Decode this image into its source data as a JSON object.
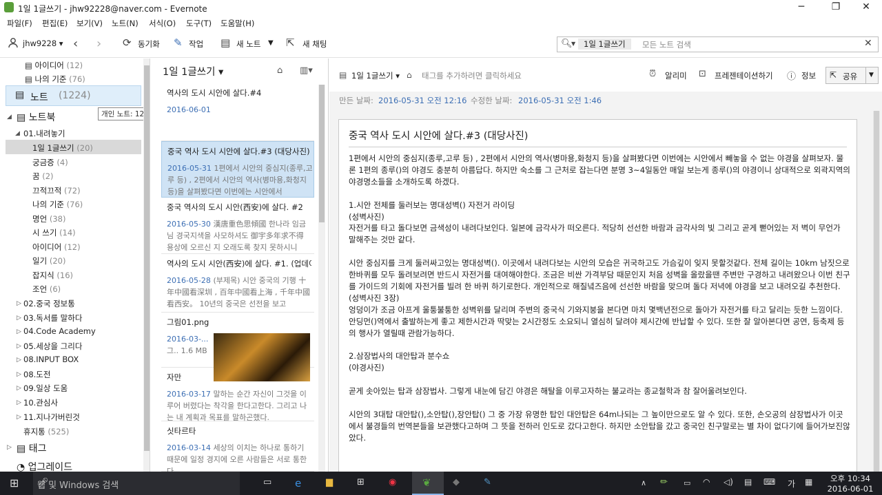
{
  "window": {
    "title": "1일 1글쓰기 - jhw92228@naver.com - Evernote"
  },
  "menu": [
    "파일(F)",
    "편집(E)",
    "보기(V)",
    "노트(N)",
    "서식(O)",
    "도구(T)",
    "도움말(H)"
  ],
  "toolbar": {
    "user": "jhw9228",
    "sync": "동기화",
    "work": "작업",
    "new_note": "새 노트",
    "new_chat": "새 채팅"
  },
  "search": {
    "scope": "1일 1글쓰기",
    "placeholder": "모든 노트 검색"
  },
  "sidebar": {
    "top_items": [
      {
        "label": "아이디어",
        "count": "(12)"
      },
      {
        "label": "나의 기준",
        "count": "(76)"
      }
    ],
    "notes": {
      "label": "노트",
      "count": "(1224)"
    },
    "tooltip": "개인 노트: 1224개",
    "notebooks_label": "노트북",
    "stack": "01.내려놓기",
    "stack_items": [
      {
        "label": "1일 1글쓰기",
        "count": "(20)"
      },
      {
        "label": "궁금증",
        "count": "(4)"
      },
      {
        "label": "꿈",
        "count": "(2)"
      },
      {
        "label": "끄적끄적",
        "count": "(72)"
      },
      {
        "label": "나의 기준",
        "count": "(76)"
      },
      {
        "label": "명언",
        "count": "(38)"
      },
      {
        "label": "시 쓰기",
        "count": "(14)"
      },
      {
        "label": "아이디어",
        "count": "(12)"
      },
      {
        "label": "일기",
        "count": "(20)"
      },
      {
        "label": "잡지식",
        "count": "(16)"
      },
      {
        "label": "조언",
        "count": "(6)"
      }
    ],
    "stacks": [
      "02.중국 정보통",
      "03.독서를 말하다",
      "04.Code Academy",
      "05.세상을 그리다",
      "08.INPUT BOX",
      "08.도전",
      "09.일상 도움",
      "10.관심사",
      "11.지나가버린것"
    ],
    "trash": {
      "label": "휴지통",
      "count": "(525)"
    },
    "tags": "태그",
    "upgrade": "업그레이드"
  },
  "list": {
    "title": "1일 1글쓰기",
    "cards": [
      {
        "title": "역사의 도시 시안에 살다.#4",
        "date": "2016-06-01",
        "text": ""
      },
      {
        "title": "중국 역사 도시 시안에 살다.#3 (대당사진)",
        "date": "2016-05-31",
        "text": "1편에서 시안의 중심지(종루,고루 등) , 2편에서 시안의 역사(병마용,화청지 등)을 살펴봤다면 이번에는 시안에서"
      },
      {
        "title": "중국 역사의 도시 시안(西安)에 살다. #2",
        "date": "2016-05-30",
        "text": "漢唐重色思傾國 한나라 임금님 경국지색을 사모하셔도 御宇多年求不得 용상에 오르신 지 오래도록 찾지 못하시니"
      },
      {
        "title": "역사의 도시 시안(西安)에 살다. #1. (업데이트)",
        "date": "2016-05-28",
        "text": "(부제목) 시안 중국의 기행 十年中國看深圳 , 百年中國看上海 , 千年中國看西安。 10년의 중국은 선전을 보고"
      },
      {
        "title": "그림01.png",
        "date": "2016-03-...",
        "text": "그..  1.6 MB"
      },
      {
        "title": "자만",
        "date": "2016-03-17",
        "text": "말하는 순간 자신이 그것을 이루어 버렸다는 착각을 한다고한다. 그리고 나는 내 계획과 목표를 말하곤했다."
      },
      {
        "title": "싯타르타",
        "date": "2016-03-14",
        "text": "세상의 이치는 하나로 통하기 때문에 일정 경지에 오른 사람들은 서로 통한다"
      }
    ]
  },
  "editor": {
    "notebook": "1일 1글쓰기",
    "tag_placeholder": "태그를 추가하려면 클릭하세요",
    "reminder": "알리미",
    "presentation": "프레젠테이션하기",
    "info": "정보",
    "share": "공유",
    "created_label": "만든 날짜:",
    "created": "2016-05-31 오전 12:16",
    "updated_label": "수정한 날짜:",
    "updated": "2016-05-31 오전 1:46",
    "note_title": "중국 역사 도시 시안에 살다.#3 (대당사진)",
    "paragraphs": [
      "1편에서 시안의 중심지(종루,고루 등) , 2편에서 시안의 역사(병마용,화청지 등)을 살펴봤다면 이번에는 시안에서 빼놓을 수 없는 야경을 살펴보자. 물론 1편의 종루()의 야경도 충분히 아름답다. 하지만 숙소를 그 근처로 잡는다면 분명 3~4일동안 매일 보는게 종루()의 야경이니 상대적으로 외곽지역의 야경명소들을 소개하도록 하겠다.",
      "",
      "1.시안 전체를 둘러보는 명대성벽() 자전거 라이딩",
      "(성벽사진)",
      "자전거를 타고 돌다보면 금색성이 내려다보인다. 일본에 금각사가 떠오른다. 적당히 선선한 바람과 금각사의 빛 그리고 곧게 뻗어있는 저 벽이 무언가 말해주는 것만 같다.",
      "",
      "시안 중심지를 크게 둘러싸고있는 명대성벽(). 이곳에서 내려다보는 시안의 모습은 귀국하고도 가슴깊이 잊지 못할것같다. 전체 길이는 10km 남짓으로 한바퀴를 모두 돌려보려면 반드시 자전거를 대여해야한다. 조금은 비싼 가격부담 때문인지 처음 성벽을 올랐을땐 주변만 구경하고 내려왔으나 이번 친구를 가이드의 기회에 자전거를 빌려 한 바퀴 하기로한다. 개인적으로 해질녘즈음에 선선한 바람을 맞으며 돌다 저녁에 야경을 보고 내려오길 추천한다.",
      "(성벽사진 3장)",
      "엉덩이가 조금 아프게 울퉁불퉁한 성벽위를 달리며 주변의 중국식 기와지붕을 본다면 마치 몇백년전으로 돌아가 자전거를 타고 달리는 듯한 느낌이다. 안딩먼()역에서 출발하는게 좋고 제한시간과 딱맞는 2시간정도 소요되니 열심히 달려야 제시간에 반납할 수 있다. 또한 잘 알아본다면 공연, 등축제 등의 행사가 열릴때 관람가능하다.",
      "",
      "2.삼장법사의 대안탑과 분수쇼",
      "(야경사진)",
      "",
      "곧게 솟아있는 탑과 삼장법사. 그렇게 내눈에 담긴 야경은 해탈을 이루고자하는 불교라는 종교철학과 참 잘어울려보인다.",
      "",
      "시안의 3대탑 대안탑(),소안탑(),장안탑() 그 중 가장 유명한 탑인 대안탑은 64m나되는 그 높이만으로도 알 수 있다. 또한, 손오공의 삼장법사가 이곳에서 불경들의 번역본들을 보관했다고하며 그 뜻을 전하러 인도로 갔다고한다. 하지만 소안탑을 갔고 중국인 친구말로는 별 차이 없다기에 들어가보진않았다."
    ]
  },
  "taskbar": {
    "search": "웹 및 Windows 검색",
    "ime": "가",
    "time": "오후 10:34",
    "date": "2016-06-01"
  },
  "colors": {
    "accent": "#3d6fb4",
    "selected": "#cfe3f5",
    "taskbar": "#1c1d22"
  }
}
